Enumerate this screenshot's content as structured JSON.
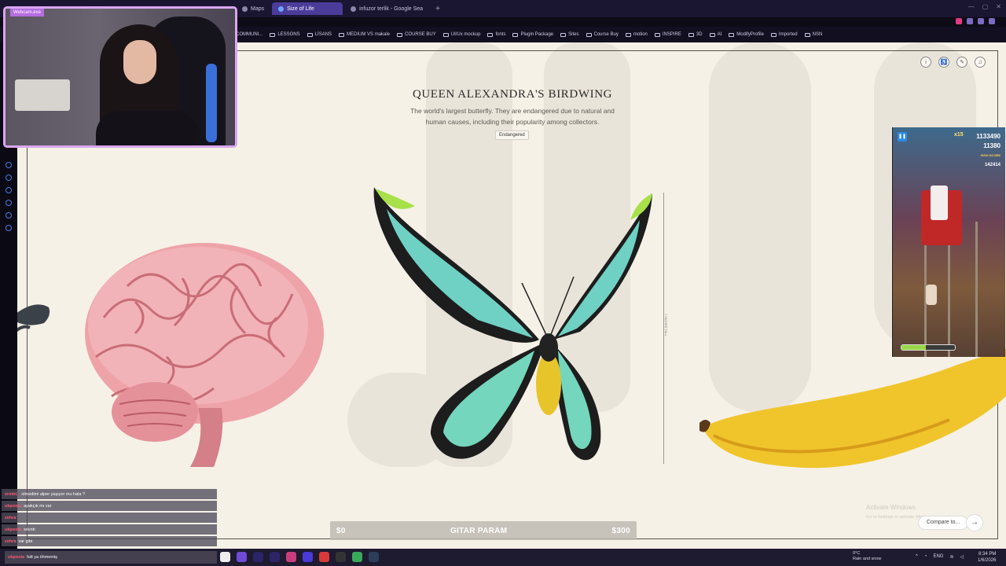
{
  "browser": {
    "tabs": [
      {
        "label": "Maps",
        "active": false
      },
      {
        "label": "Size of Life",
        "active": true
      },
      {
        "label": "infuzor terlik - Google Sea",
        "active": false
      }
    ],
    "new_tab_symbol": "+",
    "bookmarks": [
      "COMMUNI...",
      "LESSONS",
      "LİSANS",
      "MEDIUM VS makale",
      "COURSE BUY",
      "UI/Ux mockup",
      "fonts",
      "Plugin Package",
      "Sites",
      "Course Buy",
      "motion",
      "INSPIRE",
      "3D",
      "AI",
      "ModifyProfile",
      "Imported",
      "NSN"
    ]
  },
  "page": {
    "title": "QUEEN ALEXANDRA'S BIRDWING",
    "description": "The world's largest butterfly. They are endangered due to natural and human causes, including their popularity among collectors.",
    "status_badge": "Endangered",
    "measure_label": "7 INCHES TALL",
    "tool_icons": [
      "info-icon",
      "accessibility-icon",
      "pencil-icon",
      "music-icon"
    ],
    "bottom_bar": {
      "left": "$0",
      "center": "GITAR PARAM",
      "right": "$300"
    },
    "compare_label": "Compare to...",
    "next_symbol": "→",
    "watermark_title": "Activate Windows",
    "watermark_sub": "Go to Settings to activate Windows."
  },
  "webcam": {
    "label": "Webcam.exe"
  },
  "game": {
    "multiplier": "x15",
    "score": "1133490",
    "coins": "11380",
    "high_label": "HIGH SCORE",
    "high": "142414",
    "progress": 0.45
  },
  "chat": [
    {
      "user": "ermbt_",
      "text": "olmedimi alper yaşıyor mu hala ?"
    },
    {
      "user": "ukposta",
      "text": "ayakçık mı var"
    },
    {
      "user": "zehra",
      "text": ""
    },
    {
      "user": "ukposta",
      "text": "sıkıntı"
    },
    {
      "user": "zehra",
      "text": "var gibi"
    },
    {
      "user": "ukposta",
      "text": "futt ya öhmemiş"
    }
  ],
  "taskbar": {
    "weather_temp": "0°C",
    "weather_desc": "Rain and snow",
    "lang": "ENG",
    "time": "8:34 PM",
    "date": "1/6/2026"
  }
}
